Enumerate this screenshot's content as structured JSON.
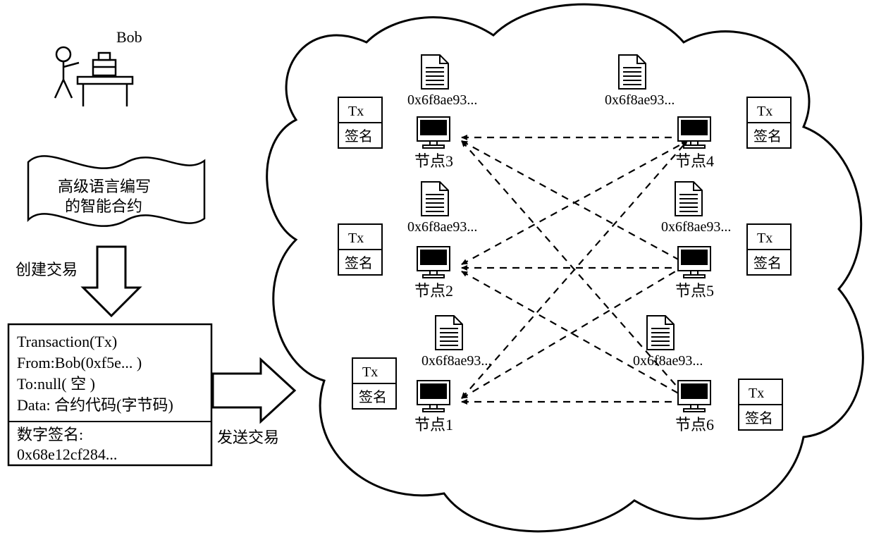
{
  "user_name": "Bob",
  "contract_banner_line1": "高级语言编写",
  "contract_banner_line2": "的智能合约",
  "arrow_create_label": "创建交易",
  "arrow_send_label": "发送交易",
  "tx_box": {
    "line1": "Transaction(Tx)",
    "line2": "From:Bob(0xf5e... )",
    "line3": "To:null( 空 )",
    "line4": "Data: 合约代码(字节码)",
    "sig_label": "数字签名:",
    "sig_value": "0x68e12cf284..."
  },
  "contract_hash": "0x6f8ae93...",
  "txcell_top": "Tx",
  "txcell_bottom": "签名",
  "nodes": {
    "n1": "节点1",
    "n2": "节点2",
    "n3": "节点3",
    "n4": "节点4",
    "n5": "节点5",
    "n6": "节点6"
  }
}
